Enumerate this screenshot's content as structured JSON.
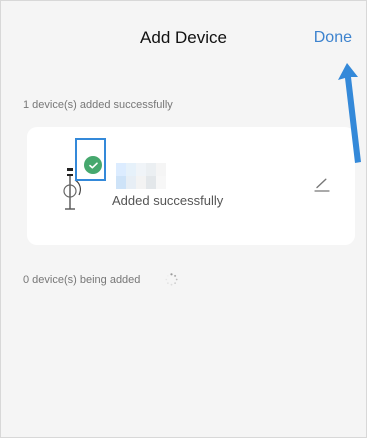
{
  "header": {
    "title": "Add Device",
    "done_label": "Done"
  },
  "sections": {
    "added_label": "1 device(s) added successfully",
    "adding_label": "0 device(s) being added"
  },
  "device": {
    "name": "",
    "status": "Added successfully",
    "image_icon": "device-icon",
    "edit_icon": "edit-icon",
    "success_icon": "checkmark-icon"
  },
  "colors": {
    "accent": "#3d83ce",
    "success": "#46a86e",
    "highlight": "#3489d9"
  }
}
